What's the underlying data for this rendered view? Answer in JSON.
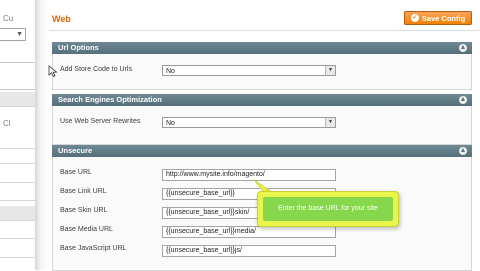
{
  "page": {
    "title": "Web",
    "save_button": "Save Config"
  },
  "left_panel": {
    "select_value": "",
    "label_1": "Cu",
    "label_2": "Cl"
  },
  "sections": {
    "url_options": {
      "title": "Url Options",
      "fields": [
        {
          "label": "Add Store Code to Urls",
          "value": "No"
        }
      ]
    },
    "seo": {
      "title": "Search Engines Optimization",
      "fields": [
        {
          "label": "Use Web Server Rewrites",
          "value": "No"
        }
      ]
    },
    "unsecure": {
      "title": "Unsecure",
      "fields": [
        {
          "label": "Base URL",
          "value": "http://www.mysite.info/magento/"
        },
        {
          "label": "Base Link URL",
          "value": "{{unsecure_base_url}}"
        },
        {
          "label": "Base Skin URL",
          "value": "{{unsecure_base_url}}skin/"
        },
        {
          "label": "Base Media URL",
          "value": "{{unsecure_base_url}}media/"
        },
        {
          "label": "Base JavaScript URL",
          "value": "{{unsecure_base_url}}js/"
        }
      ]
    }
  },
  "tooltip": {
    "text": "Enter the base URL for your site"
  },
  "icons": {
    "save": "save-icon",
    "collapse": "collapse-icon",
    "dropdown": "chevron-down-icon",
    "pointer": "mouse-pointer-icon"
  },
  "colors": {
    "title": "#e26703",
    "save_button": "#f18200",
    "section_header": "#5f7a85",
    "tooltip_outer": "#eaf54b",
    "tooltip_inner": "#86d74b"
  }
}
